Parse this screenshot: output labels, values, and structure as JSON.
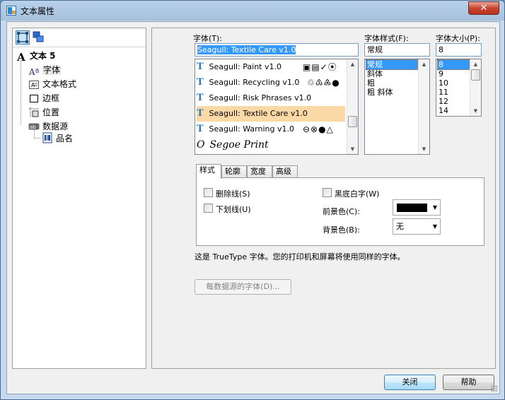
{
  "window": {
    "title": "文本属性",
    "close_glyph": "✕"
  },
  "tree_toolbar": {
    "icons": [
      "object-view-icon",
      "layers-icon"
    ]
  },
  "tree": {
    "root": {
      "label": "文本 5",
      "icon": "text-icon"
    },
    "items": [
      {
        "label": "字体",
        "icon": "font-icon",
        "selected": true
      },
      {
        "label": "文本格式",
        "icon": "text-format-icon"
      },
      {
        "label": "边框",
        "icon": "border-icon"
      },
      {
        "label": "位置",
        "icon": "position-icon"
      },
      {
        "label": "数据源",
        "icon": "datasource-icon"
      }
    ],
    "subitem": {
      "label": "品名",
      "icon": "database-field-icon"
    }
  },
  "font": {
    "label": "字体(T):",
    "value": "Seagull: Textile Care v1.0",
    "list": [
      {
        "name": "Seagull: Paint v1.0",
        "glyphs": "▣▤✓⦿",
        "type": "truetype"
      },
      {
        "name": "Seagull: Recycling v1.0",
        "glyphs": "♲♳♶●",
        "type": "truetype"
      },
      {
        "name": "Seagull: Risk Phrases v1.0",
        "glyphs": "",
        "type": "truetype"
      },
      {
        "name": "Seagull: Textile Care v1.0",
        "glyphs": "",
        "type": "truetype",
        "selected": true
      },
      {
        "name": "Seagull: Warning v1.0",
        "glyphs": "⊖⊗●△",
        "type": "truetype"
      },
      {
        "name": "Segoe Print",
        "glyphs": "",
        "type": "opentype"
      }
    ]
  },
  "font_style": {
    "label": "字体样式(F):",
    "value": "常规",
    "options": [
      "常规",
      "斜体",
      "粗",
      "粗 斜体"
    ],
    "selected_index": 0
  },
  "font_size": {
    "label": "字体大小(P):",
    "value": "8",
    "options": [
      "8",
      "9",
      "10",
      "11",
      "12",
      "14"
    ],
    "selected_index": 0
  },
  "tabs": [
    "样式",
    "轮廓",
    "宽度",
    "高级"
  ],
  "style_tab": {
    "strikeout": "删除线(S)",
    "underline": "下划线(U)",
    "reverse": "黑底白字(W)",
    "foreground_label": "前景色(C):",
    "foreground_color": "#000000",
    "background_label": "背景色(B):",
    "background_value": "无"
  },
  "description": "这是 TrueType 字体。您的打印机和屏幕将使用同样的字体。",
  "per_datasource_button": "每数据源的字体(D)...",
  "buttons": {
    "close": "关闭",
    "help": "帮助"
  }
}
